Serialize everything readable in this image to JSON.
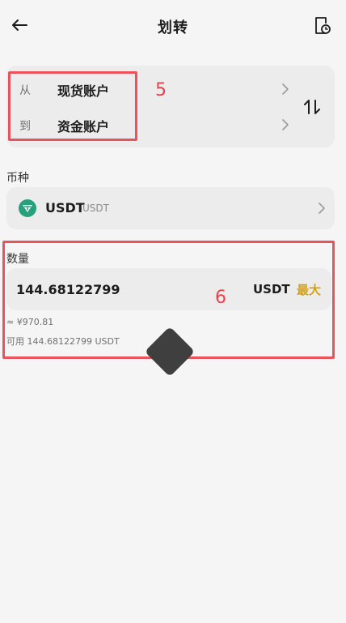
{
  "header": {
    "title": "划转"
  },
  "accounts": {
    "from_prefix": "从",
    "from_account": "现货账户",
    "to_prefix": "到",
    "to_account": "资金账户"
  },
  "currency": {
    "label": "币种",
    "code": "USDT",
    "sub": "USDT",
    "brand_color": "#26a17b"
  },
  "amount": {
    "label": "数量",
    "value": "144.68122799",
    "unit": "USDT",
    "max_label": "最大",
    "approx": "≈ ¥970.81",
    "available": "可用 144.68122799 USDT",
    "max_color": "#d4a017"
  },
  "annotations": {
    "box5_number": "5",
    "box6_number": "6",
    "color": "#e8434c"
  }
}
